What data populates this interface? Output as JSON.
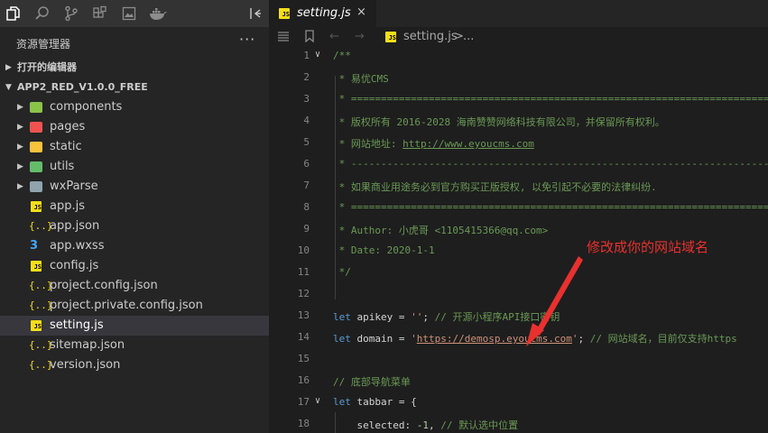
{
  "sidebar": {
    "title": "资源管理器",
    "more": "···",
    "open_editors": "打开的编辑器",
    "project": "APP2_RED_V1.0.0_FREE",
    "items": [
      {
        "label": "components",
        "kind": "folder",
        "color": "#8bc34a"
      },
      {
        "label": "pages",
        "kind": "folder",
        "color": "#ef5350"
      },
      {
        "label": "static",
        "kind": "folder",
        "color": "#f9c23c"
      },
      {
        "label": "utils",
        "kind": "folder",
        "color": "#66bb6a"
      },
      {
        "label": "wxParse",
        "kind": "folder",
        "color": "#90a4ae"
      },
      {
        "label": "app.js",
        "kind": "js"
      },
      {
        "label": "app.json",
        "kind": "json"
      },
      {
        "label": "app.wxss",
        "kind": "css"
      },
      {
        "label": "config.js",
        "kind": "js"
      },
      {
        "label": "project.config.json",
        "kind": "json"
      },
      {
        "label": "project.private.config.json",
        "kind": "json"
      },
      {
        "label": "setting.js",
        "kind": "js",
        "selected": true
      },
      {
        "label": "sitemap.json",
        "kind": "json"
      },
      {
        "label": "version.json",
        "kind": "json"
      }
    ]
  },
  "tab": {
    "name": "setting.js",
    "close": "×"
  },
  "breadcrumb": {
    "file": "setting.js",
    "sep": ">",
    "more": "..."
  },
  "editor": {
    "l1": "/**",
    "l2": " * 易优CMS",
    "l3": " * ===================================================================================================",
    "l4": " * 版权所有 2016-2028 海南赞赞网络科技有限公司，并保留所有权利。",
    "l5a": " * 网站地址: ",
    "l5b": "http://www.eyoucms.com",
    "l6": " * ---------------------------------------------------------------------------------------------------",
    "l7": " * 如果商业用途务必到官方购买正版授权, 以免引起不必要的法律纠纷.",
    "l8": " * ===================================================================================================",
    "l9": " * Author: 小虎哥 <1105415366@qq.com>",
    "l10": " * Date: 2020-1-1",
    "l11": " */",
    "l13_kw": "let",
    "l13_a": " apikey = ",
    "l13_s": "''",
    "l13_b": "; ",
    "l13_c": "// 开源小程序API接口密钥",
    "l14_kw": "let",
    "l14_a": " domain = ",
    "l14_q1": "'",
    "l14_url": "https://demosp.eyoucms.com",
    "l14_q2": "'",
    "l14_b": "; ",
    "l14_c": "// 网站域名，目前仅支持https",
    "l16": "// 底部导航菜单",
    "l17_kw": "let",
    "l17_a": " tabbar = {",
    "l18_a": "    selected: ",
    "l18_n": "-1",
    "l18_b": ", ",
    "l18_c": "// 默认选中位置",
    "line_numbers": [
      "1",
      "2",
      "3",
      "4",
      "5",
      "6",
      "7",
      "8",
      "9",
      "10",
      "11",
      "12",
      "13",
      "14",
      "15",
      "16",
      "17",
      "18"
    ]
  },
  "annotation": {
    "text": "修改成你的网站域名",
    "color": "#e8312f"
  }
}
